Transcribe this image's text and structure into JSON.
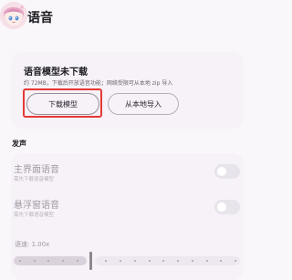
{
  "header": {
    "title": "语音"
  },
  "download_card": {
    "title": "语音模型未下载",
    "desc": "约 72MB，下载后开放语音功能；网络受限可从本地 zip 导入",
    "download_label": "下载模型",
    "import_label": "从本地导入"
  },
  "voice_section": {
    "title": "发声",
    "rows": [
      {
        "title": "主界面语音",
        "subtitle": "需先下载语音模型",
        "enabled": false
      },
      {
        "title": "悬浮窗语音",
        "subtitle": "需先下载语音模型",
        "enabled": false
      }
    ],
    "speed_label": "语速: 1.00x",
    "speed": {
      "min": 0.5,
      "max": 2.0,
      "value": 1.0,
      "steps": 15
    }
  },
  "colors": {
    "highlight": "#e53935",
    "accent": "#9a8c96"
  }
}
